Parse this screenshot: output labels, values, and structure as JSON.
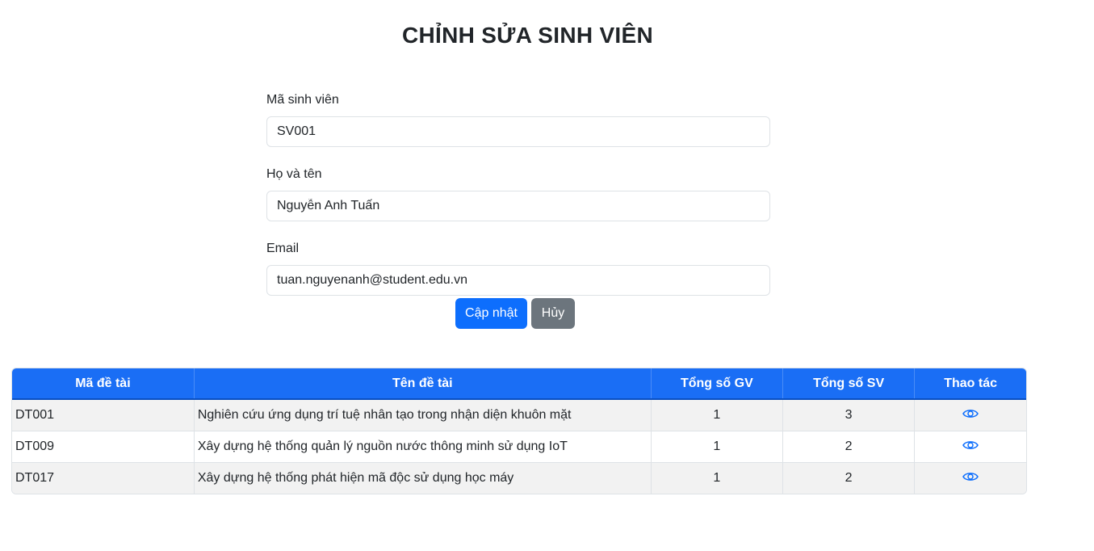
{
  "page": {
    "title": "CHỈNH SỬA SINH VIÊN"
  },
  "form": {
    "student_id": {
      "label": "Mã sinh viên",
      "value": "SV001"
    },
    "full_name": {
      "label": "Họ và tên",
      "value": "Nguyễn Anh Tuấn"
    },
    "email": {
      "label": "Email",
      "value": "tuan.nguyenanh@student.edu.vn"
    },
    "update_label": "Cập nhật",
    "cancel_label": "Hủy"
  },
  "table": {
    "headers": [
      "Mã đề tài",
      "Tên đề tài",
      "Tổng số GV",
      "Tổng số SV",
      "Thao tác"
    ],
    "rows": [
      {
        "code": "DT001",
        "name": "Nghiên cứu ứng dụng trí tuệ nhân tạo trong nhận diện khuôn mặt",
        "teachers": "1",
        "students": "3",
        "action_icon": "eye-icon"
      },
      {
        "code": "DT009",
        "name": "Xây dựng hệ thống quản lý nguồn nước thông minh sử dụng IoT",
        "teachers": "1",
        "students": "2",
        "action_icon": "eye-icon"
      },
      {
        "code": "DT017",
        "name": "Xây dựng hệ thống phát hiện mã độc sử dụng học máy",
        "teachers": "1",
        "students": "2",
        "action_icon": "eye-icon"
      }
    ]
  },
  "colors": {
    "primary": "#0d6efd",
    "secondary": "#6c757d",
    "table_header": "#1a6ef5"
  }
}
